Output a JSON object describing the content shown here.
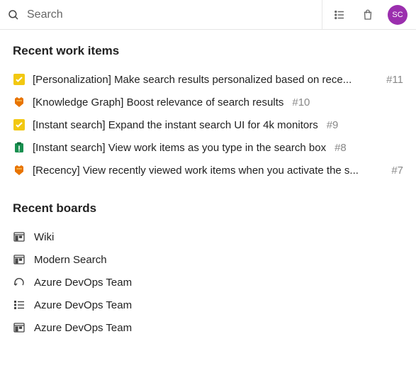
{
  "search": {
    "placeholder": "Search",
    "value": ""
  },
  "avatar": {
    "initials": "SC"
  },
  "sections": {
    "recentWorkItems": {
      "title": "Recent work items",
      "items": [
        {
          "icon": "task",
          "title": "[Personalization] Make search results personalized based on rece...",
          "id": "#11",
          "truncated": true
        },
        {
          "icon": "epic",
          "title": "[Knowledge Graph] Boost relevance of search results",
          "id": "#10",
          "truncated": false
        },
        {
          "icon": "task",
          "title": "[Instant search] Expand the instant search UI for 4k monitors",
          "id": "#9",
          "truncated": false
        },
        {
          "icon": "testcase",
          "title": "[Instant search] View work items as you type in the search box",
          "id": "#8",
          "truncated": false
        },
        {
          "icon": "epic",
          "title": "[Recency] View recently viewed work items when you activate the s...",
          "id": "#7",
          "truncated": true
        }
      ]
    },
    "recentBoards": {
      "title": "Recent boards",
      "items": [
        {
          "icon": "taskboard",
          "title": "Wiki"
        },
        {
          "icon": "taskboard",
          "title": "Modern Search"
        },
        {
          "icon": "sprint",
          "title": "Azure DevOps Team"
        },
        {
          "icon": "backlog",
          "title": "Azure DevOps Team"
        },
        {
          "icon": "taskboard",
          "title": "Azure DevOps Team"
        }
      ]
    }
  }
}
